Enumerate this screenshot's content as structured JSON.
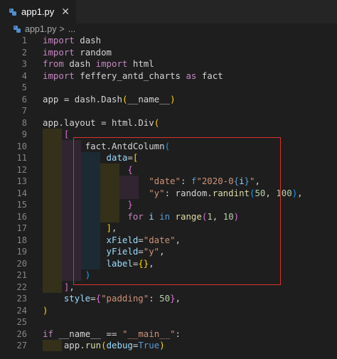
{
  "tab": {
    "label": "app1.py",
    "close_glyph": "✕"
  },
  "breadcrumb": {
    "file": "app1.py",
    "separator": ">",
    "more": "..."
  },
  "line_numbers": [
    "1",
    "2",
    "3",
    "4",
    "5",
    "6",
    "7",
    "8",
    "9",
    "10",
    "11",
    "12",
    "13",
    "14",
    "15",
    "16",
    "17",
    "18",
    "19",
    "20",
    "21",
    "22",
    "23",
    "24",
    "25",
    "26",
    "27"
  ],
  "tokens": {
    "import": "import",
    "from": "from",
    "as": "as",
    "for": "for",
    "in": "in",
    "if": "if",
    "dash": "dash",
    "random": "random",
    "html": "html",
    "feffery_antd_charts": "feffery_antd_charts",
    "fact": "fact",
    "app": "app",
    "eq": "=",
    "eqeq": "==",
    "dot": ".",
    "Dash": "Dash",
    "layout": "layout",
    "Div": "Div",
    "AntdColumn": "AntdColumn",
    "run": "run",
    "dunder_name": "__name__",
    "main_str": "\"__main__\"",
    "lparen": "(",
    "rparen": ")",
    "lbracket": "[",
    "rbracket": "]",
    "lbrace": "{",
    "rbrace": "}",
    "comma": ",",
    "colon": ":",
    "data_kw": "data",
    "date_key": "\"date\"",
    "fprefix": "f",
    "fstr_body": "\"2020-0",
    "i": "i",
    "fstr_end": "\"",
    "y_key": "\"y\"",
    "randint": "randint",
    "n50": "50",
    "n100": "100",
    "range": "range",
    "n1": "1",
    "n10": "10",
    "xField": "xField",
    "date_val": "\"date\"",
    "yField": "yField",
    "y_val": "\"y\"",
    "label": "label",
    "style": "style",
    "padding_key": "\"padding\"",
    "debug": "debug",
    "True": "True"
  },
  "icons": {
    "tab_file_icon": "python-file-icon",
    "breadcrumb_file_icon": "python-file-icon"
  },
  "colors": {
    "background": "#1e1e1e",
    "keyword": "#c586c0",
    "builtin": "#569cd6",
    "string": "#ce9178",
    "variable": "#9cdcfe",
    "function": "#dcdcaa",
    "number": "#b5cea8",
    "bracket_level1": "#ffd700",
    "bracket_level2": "#da70d6",
    "bracket_level3": "#179fff",
    "highlight_box": "#d9322e"
  }
}
